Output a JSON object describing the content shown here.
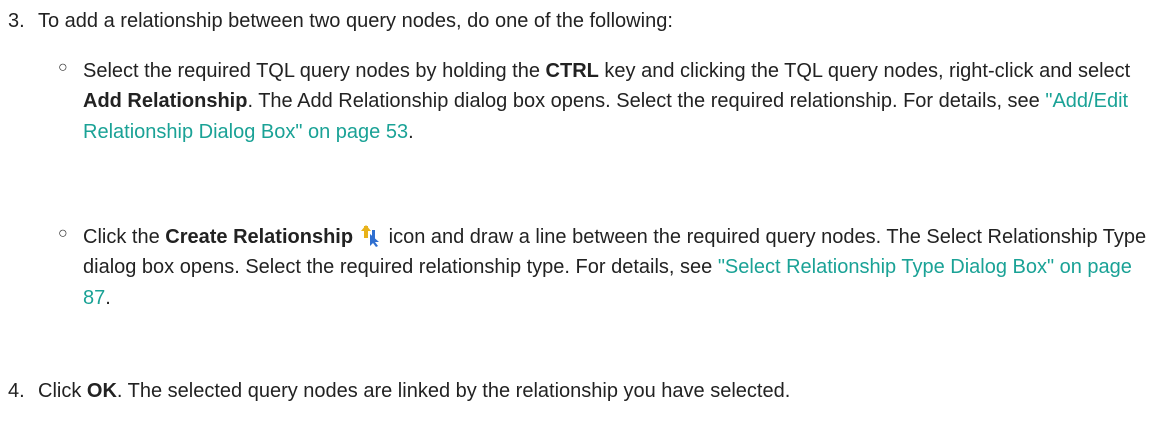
{
  "step3": {
    "number": "3.",
    "text": "To add a relationship between two query nodes, do one of the following:",
    "options": [
      {
        "bullet": "○",
        "t1": "Select the required TQL query nodes by holding the ",
        "b1": "CTRL",
        "t2": " key and clicking the TQL query nodes, right-click and select ",
        "b2": "Add Relationship",
        "t3": ". The Add Relationship dialog box opens. Select the required relationship. For details, see ",
        "link": "\"Add/Edit Relationship Dialog Box\" on page 53",
        "t4": "."
      },
      {
        "bullet": "○",
        "t1": "Click the ",
        "b1": "Create Relationship",
        "icon": "create-relationship-icon",
        "t2": " icon and draw a line between the required query nodes. The Select Relationship Type dialog box opens. Select the required relationship type. For details, see ",
        "link": "\"Select Relationship Type Dialog Box\" on page 87",
        "t3": "."
      }
    ]
  },
  "step4": {
    "number": "4.",
    "t1": "Click ",
    "b1": "OK",
    "t2": ". The selected query nodes are linked by the relationship you have selected."
  },
  "colors": {
    "text": "#222222",
    "link": "#1aa296",
    "icon_blue": "#2f6fd0",
    "icon_yellow": "#e8b21a"
  }
}
